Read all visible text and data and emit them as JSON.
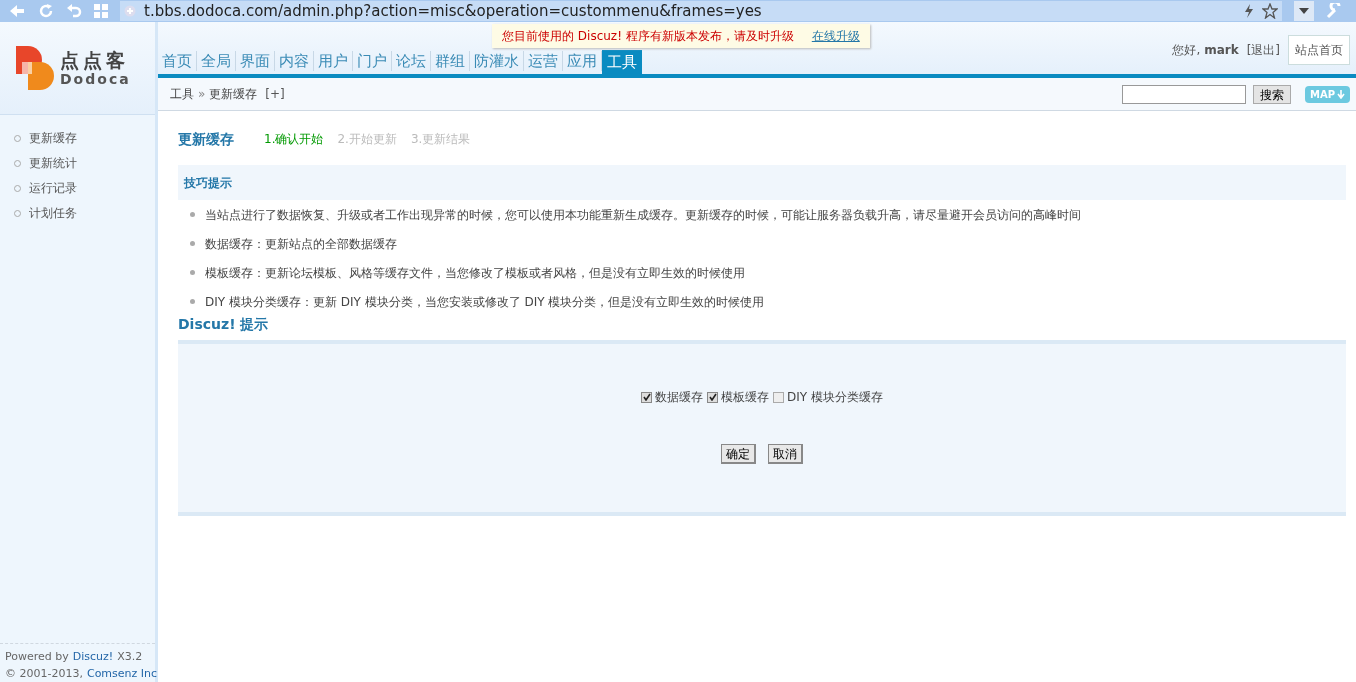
{
  "browser": {
    "url": "t.bbs.dodoca.com/admin.php?action=misc&operation=custommenu&frames=yes"
  },
  "notice": {
    "text": "您目前使用的 Discuz! 程序有新版本发布，请及时升级",
    "link": "在线升级"
  },
  "logo": {
    "title": "点点客",
    "subtitle": "Dodoca"
  },
  "nav": [
    {
      "label": "首页",
      "selected": false
    },
    {
      "label": "全局",
      "selected": false
    },
    {
      "label": "界面",
      "selected": false
    },
    {
      "label": "内容",
      "selected": false
    },
    {
      "label": "用户",
      "selected": false
    },
    {
      "label": "门户",
      "selected": false
    },
    {
      "label": "论坛",
      "selected": false
    },
    {
      "label": "群组",
      "selected": false
    },
    {
      "label": "防灌水",
      "selected": false
    },
    {
      "label": "运营",
      "selected": false
    },
    {
      "label": "应用",
      "selected": false
    },
    {
      "label": "工具",
      "selected": true
    }
  ],
  "user": {
    "greeting": "您好,",
    "name": "mark",
    "logout": "[退出]",
    "home_button": "站点首页"
  },
  "breadcrumb": {
    "parent": "工具",
    "separator": "»",
    "current": "更新缓存",
    "add": "[+]"
  },
  "search": {
    "button": "搜索",
    "map": "MAP"
  },
  "sidebar": {
    "items": [
      {
        "label": "更新缓存"
      },
      {
        "label": "更新统计"
      },
      {
        "label": "运行记录"
      },
      {
        "label": "计划任务"
      }
    ],
    "footer": {
      "prefix": "Powered by",
      "link": "Discuz!",
      "version": "X3.2",
      "copyright": "© 2001-2013,",
      "company": "Comsenz Inc"
    }
  },
  "page": {
    "title": "更新缓存",
    "steps": [
      {
        "label": "1.确认开始",
        "selected": true
      },
      {
        "label": "2.开始更新",
        "selected": false
      },
      {
        "label": "3.更新结果",
        "selected": false
      }
    ]
  },
  "tips": {
    "title": "技巧提示",
    "items": [
      "当站点进行了数据恢复、升级或者工作出现异常的时候，您可以使用本功能重新生成缓存。更新缓存的时候，可能让服务器负载升高，请尽量避开会员访问的高峰时间",
      "数据缓存：更新站点的全部数据缓存",
      "模板缓存：更新论坛模板、风格等缓存文件，当您修改了模板或者风格，但是没有立即生效的时候使用",
      "DIY 模块分类缓存：更新 DIY 模块分类，当您安装或修改了 DIY 模块分类，但是没有立即生效的时候使用"
    ]
  },
  "form": {
    "title": "Discuz! 提示",
    "options": [
      {
        "label": "数据缓存",
        "checked": true
      },
      {
        "label": "模板缓存",
        "checked": true
      },
      {
        "label": "DIY 模块分类缓存",
        "checked": false
      }
    ],
    "buttons": [
      "确定",
      "取消"
    ]
  }
}
